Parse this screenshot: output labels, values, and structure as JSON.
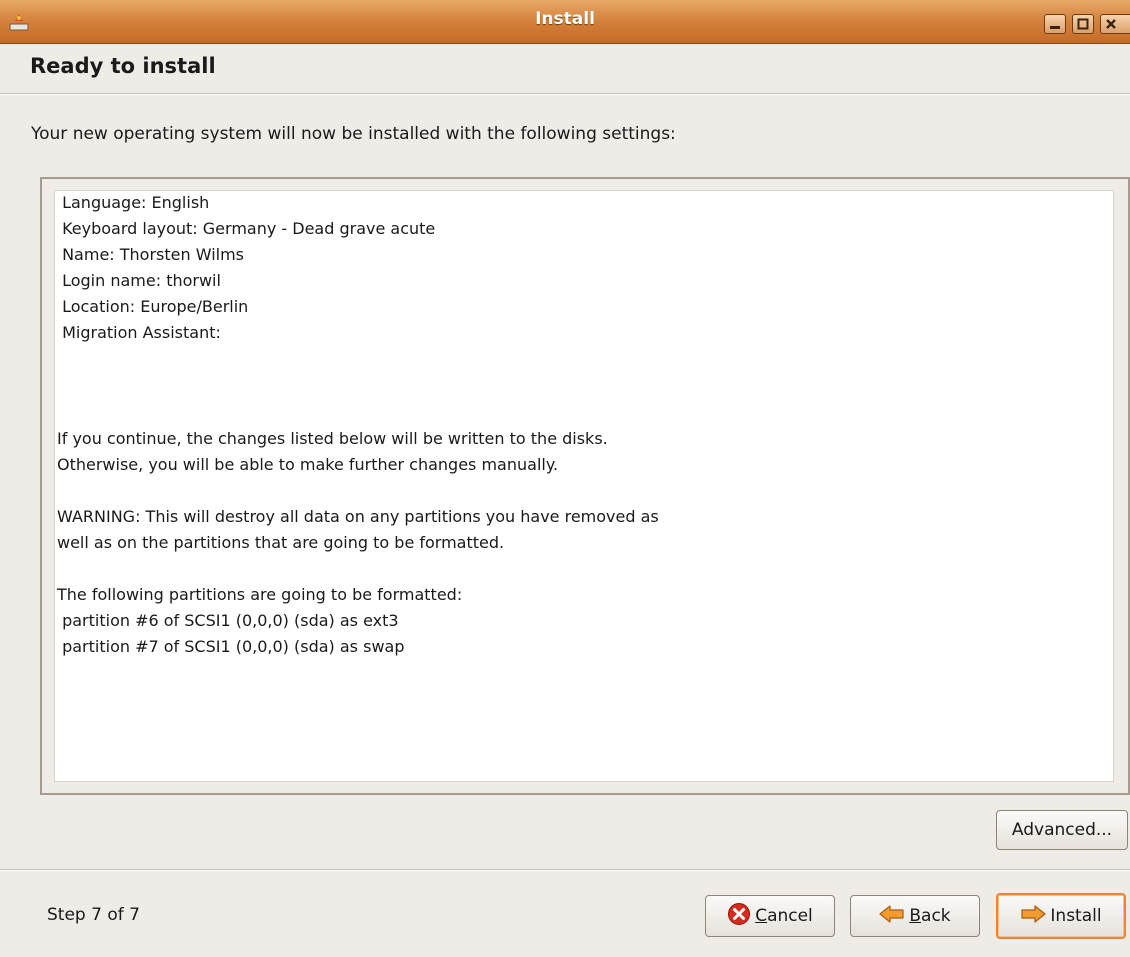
{
  "window": {
    "title": "Install"
  },
  "header": {
    "title": "Ready to install"
  },
  "intro": "Your new operating system will now be installed with the following settings:",
  "summary": {
    "lines": [
      " Language: English",
      " Keyboard layout: Germany - Dead grave acute",
      " Name: Thorsten Wilms",
      " Login name: thorwil",
      " Location: Europe/Berlin",
      " Migration Assistant:",
      "If you continue, the changes listed below will be written to the disks.",
      "Otherwise, you will be able to make further changes manually.",
      "WARNING: This will destroy all data on any partitions you have removed as",
      "well as on the partitions that are going to be formatted.",
      "The following partitions are going to be formatted:",
      " partition #6 of SCSI1 (0,0,0) (sda) as ext3",
      " partition #7 of SCSI1 (0,0,0) (sda) as swap"
    ]
  },
  "buttons": {
    "advanced": "Advanced...",
    "cancel_prefix": "",
    "cancel_mnemonic": "C",
    "cancel_rest": "ancel",
    "back_mnemonic": "B",
    "back_rest": "ack",
    "install": "Install"
  },
  "footer": {
    "step": "Step 7 of 7"
  },
  "colors": {
    "titlebar": "#d4803a",
    "window_bg": "#efebe7",
    "install_border": "#e8873a"
  },
  "icons": {
    "app": "installer-icon",
    "cancel": "cancel-icon",
    "back": "back-arrow-icon",
    "install": "forward-arrow-icon"
  }
}
